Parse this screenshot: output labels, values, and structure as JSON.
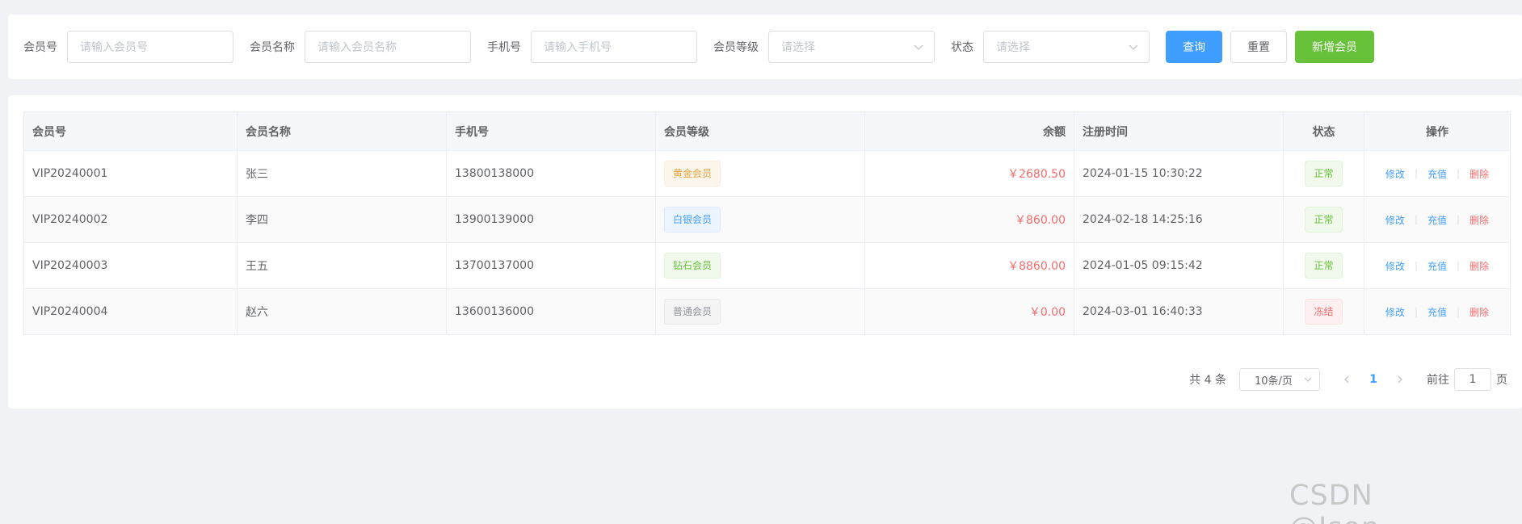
{
  "search": {
    "fields": [
      {
        "label": "会员号",
        "placeholder": "请输入会员号"
      },
      {
        "label": "会员名称",
        "placeholder": "请输入会员名称"
      },
      {
        "label": "手机号",
        "placeholder": "请输入手机号"
      },
      {
        "label": "会员等级",
        "placeholder": "请选择"
      },
      {
        "label": "状态",
        "placeholder": "请选择"
      }
    ],
    "buttons": {
      "query": "查询",
      "reset": "重置",
      "add": "新增会员"
    }
  },
  "table": {
    "columns": [
      "会员号",
      "会员名称",
      "手机号",
      "会员等级",
      "余额",
      "注册时间",
      "状态",
      "操作"
    ],
    "rows": [
      {
        "id": "VIP20240001",
        "name": "张三",
        "phone": "13800138000",
        "level": "黄金会员",
        "balance": "￥2680.50",
        "time": "2024-01-15 10:30:22",
        "status": "正常"
      },
      {
        "id": "VIP20240002",
        "name": "李四",
        "phone": "13900139000",
        "level": "白银会员",
        "balance": "￥860.00",
        "time": "2024-02-18 14:25:16",
        "status": "正常"
      },
      {
        "id": "VIP20240003",
        "name": "王五",
        "phone": "13700137000",
        "level": "钻石会员",
        "balance": "￥8860.00",
        "time": "2024-01-05 09:15:42",
        "status": "正常"
      },
      {
        "id": "VIP20240004",
        "name": "赵六",
        "phone": "13600136000",
        "level": "普通会员",
        "balance": "￥0.00",
        "time": "2024-03-01 16:40:33",
        "status": "冻结"
      }
    ],
    "actions": {
      "edit": "修改",
      "recharge": "充值",
      "delete": "删除"
    },
    "divider": "|"
  },
  "pagination": {
    "total": "共 4 条",
    "page_size": "10条/页",
    "current_page": "1",
    "goto_label": "前往",
    "goto_value": "1",
    "page_suffix": "页"
  },
  "watermark": "CSDN @Json_____",
  "colors": {
    "primary": "#409eff",
    "success": "#67c23a",
    "danger": "#f56c6c",
    "warning": "#e6a23c"
  }
}
